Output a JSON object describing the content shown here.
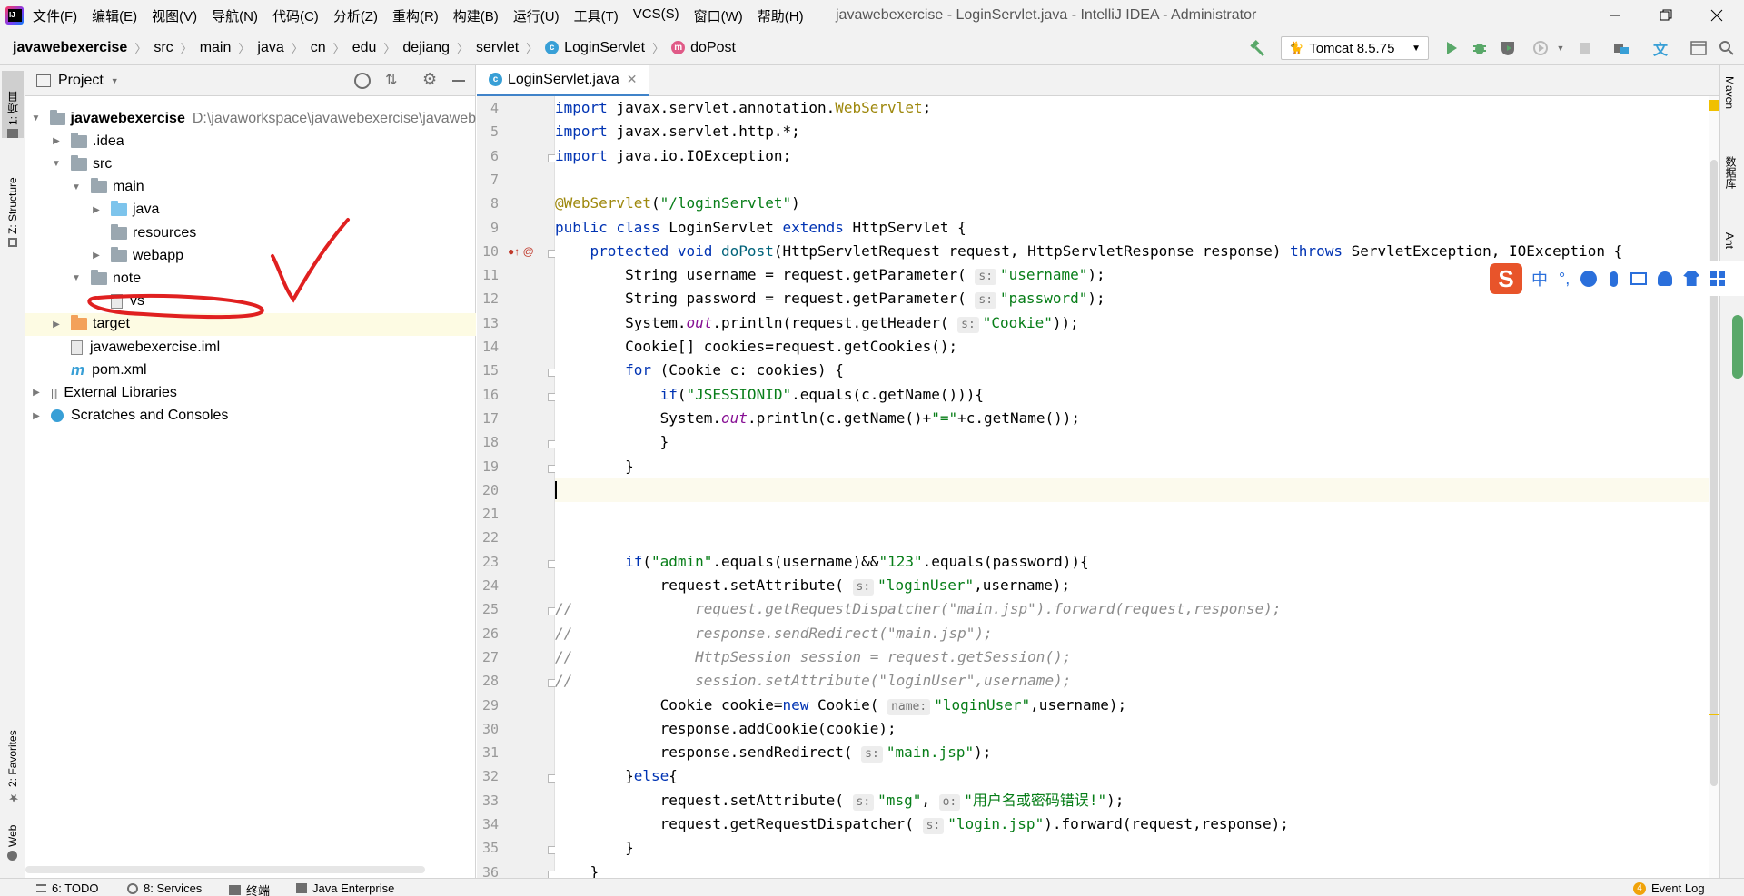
{
  "menubar": {
    "items": [
      "文件(F)",
      "编辑(E)",
      "视图(V)",
      "导航(N)",
      "代码(C)",
      "分析(Z)",
      "重构(R)",
      "构建(B)",
      "运行(U)",
      "工具(T)",
      "VCS(S)",
      "窗口(W)",
      "帮助(H)"
    ],
    "window_title": "javawebexercise - LoginServlet.java - IntelliJ IDEA - Administrator"
  },
  "breadcrumbs": [
    "javawebexercise",
    "src",
    "main",
    "java",
    "cn",
    "edu",
    "dejiang",
    "servlet",
    "LoginServlet",
    "doPost"
  ],
  "toolbar": {
    "run_config": "Tomcat 8.5.75"
  },
  "left_stripe": {
    "project": "1: 项目",
    "structure": "Z: Structure",
    "favorites": "2: Favorites",
    "web": "Web"
  },
  "project": {
    "title": "Project",
    "tree": [
      {
        "label": "javawebexercise",
        "path": "D:\\javaworkspace\\javawebexercise\\javaweb",
        "depth": 0,
        "arrow": "open",
        "icon": "folder",
        "bold": true
      },
      {
        "label": ".idea",
        "depth": 1,
        "arrow": "closed",
        "icon": "folder"
      },
      {
        "label": "src",
        "depth": 1,
        "arrow": "open",
        "icon": "folder"
      },
      {
        "label": "main",
        "depth": 2,
        "arrow": "open",
        "icon": "folder"
      },
      {
        "label": "java",
        "depth": 3,
        "arrow": "closed",
        "icon": "folder-blue"
      },
      {
        "label": "resources",
        "depth": 3,
        "arrow": "none",
        "icon": "folder"
      },
      {
        "label": "webapp",
        "depth": 3,
        "arrow": "closed",
        "icon": "folder-web"
      },
      {
        "label": "note",
        "depth": 2,
        "arrow": "open",
        "icon": "folder"
      },
      {
        "label": "vs",
        "depth": 3,
        "arrow": "none",
        "icon": "file"
      },
      {
        "label": "target",
        "depth": 1,
        "arrow": "closed",
        "icon": "folder-orange",
        "selected": true
      },
      {
        "label": "javawebexercise.iml",
        "depth": 1,
        "arrow": "none",
        "icon": "file"
      },
      {
        "label": "pom.xml",
        "depth": 1,
        "arrow": "none",
        "icon": "maven"
      },
      {
        "label": "External Libraries",
        "depth": 0,
        "arrow": "closed",
        "icon": "library"
      },
      {
        "label": "Scratches and Consoles",
        "depth": 0,
        "arrow": "closed",
        "icon": "scratch"
      }
    ]
  },
  "editor": {
    "tab_label": "LoginServlet.java",
    "lines": [
      {
        "n": "4",
        "html": "<span class=\"kw\">import</span> javax.servlet.annotation.<span class=\"ann\">WebServlet</span>;"
      },
      {
        "n": "5",
        "html": "<span class=\"kw\">import</span> javax.servlet.http.*;"
      },
      {
        "n": "6",
        "html": "<span class=\"kw\">import</span> java.io.IOException;"
      },
      {
        "n": "7",
        "html": ""
      },
      {
        "n": "8",
        "html": "<span class=\"ann\">@WebServlet</span>(<span class=\"str\">\"/loginServlet\"</span>)"
      },
      {
        "n": "9",
        "html": "<span class=\"kw\">public class</span> LoginServlet <span class=\"kw\">extends</span> HttpServlet {"
      },
      {
        "n": "10",
        "html": "    <span class=\"kw\">protected void</span> <span style=\"color:#00627a\">doPost</span>(HttpServletRequest request, HttpServletResponse response) <span class=\"kw\">throws</span> ServletException, IOException {"
      },
      {
        "n": "11",
        "html": "        String username = request.getParameter( <span class=\"hint\">s:</span><span class=\"str\">\"username\"</span>);"
      },
      {
        "n": "12",
        "html": "        String password = request.getParameter( <span class=\"hint\">s:</span><span class=\"str\">\"password\"</span>);"
      },
      {
        "n": "13",
        "html": "        System.<span class=\"fld\">out</span>.println(request.getHeader( <span class=\"hint\">s:</span><span class=\"str\">\"Cookie\"</span>));"
      },
      {
        "n": "14",
        "html": "        Cookie[] cookies=request.getCookies();"
      },
      {
        "n": "15",
        "html": "        <span class=\"kw\">for</span> (Cookie c: cookies) {"
      },
      {
        "n": "16",
        "html": "            <span class=\"kw\">if</span>(<span class=\"str\">\"JSESSIONID\"</span>.equals(c.getName())){"
      },
      {
        "n": "17",
        "html": "            System.<span class=\"fld\">out</span>.println(c.getName()+<span class=\"str\">\"=\"</span>+c.getName());"
      },
      {
        "n": "18",
        "html": "            }"
      },
      {
        "n": "19",
        "html": "        }"
      },
      {
        "n": "20",
        "html": "<span class=\"cursor\"></span>",
        "current": true
      },
      {
        "n": "21",
        "html": ""
      },
      {
        "n": "22",
        "html": ""
      },
      {
        "n": "23",
        "html": "        <span class=\"kw\">if</span>(<span class=\"str\">\"admin\"</span>.equals(username)&amp;&amp;<span class=\"str\">\"123\"</span>.equals(password)){"
      },
      {
        "n": "24",
        "html": "            request.setAttribute( <span class=\"hint\">s:</span><span class=\"str\">\"loginUser\"</span>,username);"
      },
      {
        "n": "25",
        "html": "<span class=\"cmt\">//              request.getRequestDispatcher(\"main.jsp\").forward(request,response);</span>"
      },
      {
        "n": "26",
        "html": "<span class=\"cmt\">//              response.sendRedirect(\"main.jsp\");</span>"
      },
      {
        "n": "27",
        "html": "<span class=\"cmt\">//              HttpSession session = request.getSession();</span>"
      },
      {
        "n": "28",
        "html": "<span class=\"cmt\">//              session.setAttribute(\"loginUser\",username);</span>"
      },
      {
        "n": "29",
        "html": "            Cookie cookie=<span class=\"kw\">new</span> Cookie( <span class=\"hint\">name:</span><span class=\"str\">\"loginUser\"</span>,username);"
      },
      {
        "n": "30",
        "html": "            response.addCookie(cookie);"
      },
      {
        "n": "31",
        "html": "            response.sendRedirect( <span class=\"hint\">s:</span><span class=\"str\">\"main.jsp\"</span>);"
      },
      {
        "n": "32",
        "html": "        }<span class=\"kw\">else</span>{"
      },
      {
        "n": "33",
        "html": "            request.setAttribute( <span class=\"hint\">s:</span><span class=\"str\">\"msg\"</span>, <span class=\"hint\">o:</span><span class=\"str\">\"用户名或密码错误!\"</span>);"
      },
      {
        "n": "34",
        "html": "            request.getRequestDispatcher( <span class=\"hint\">s:</span><span class=\"str\">\"login.jsp\"</span>).forward(request,response);"
      },
      {
        "n": "35",
        "html": "        }"
      },
      {
        "n": "36",
        "html": "    }"
      }
    ]
  },
  "right_stripe": {
    "maven": "Maven",
    "database": "数据库",
    "ant": "Ant"
  },
  "bottom_bar": {
    "todo": "6: TODO",
    "services": "8: Services",
    "terminal": "终端",
    "java_enterprise": "Java Enterprise",
    "event_log": "Event Log",
    "event_count": "4"
  },
  "ime": {
    "lang": "中"
  },
  "colors": {
    "accent": "#4083c9",
    "keyword": "#0033b3",
    "string": "#067d17",
    "annotation": "#9e880d",
    "annotation_mark": "#e02020"
  }
}
